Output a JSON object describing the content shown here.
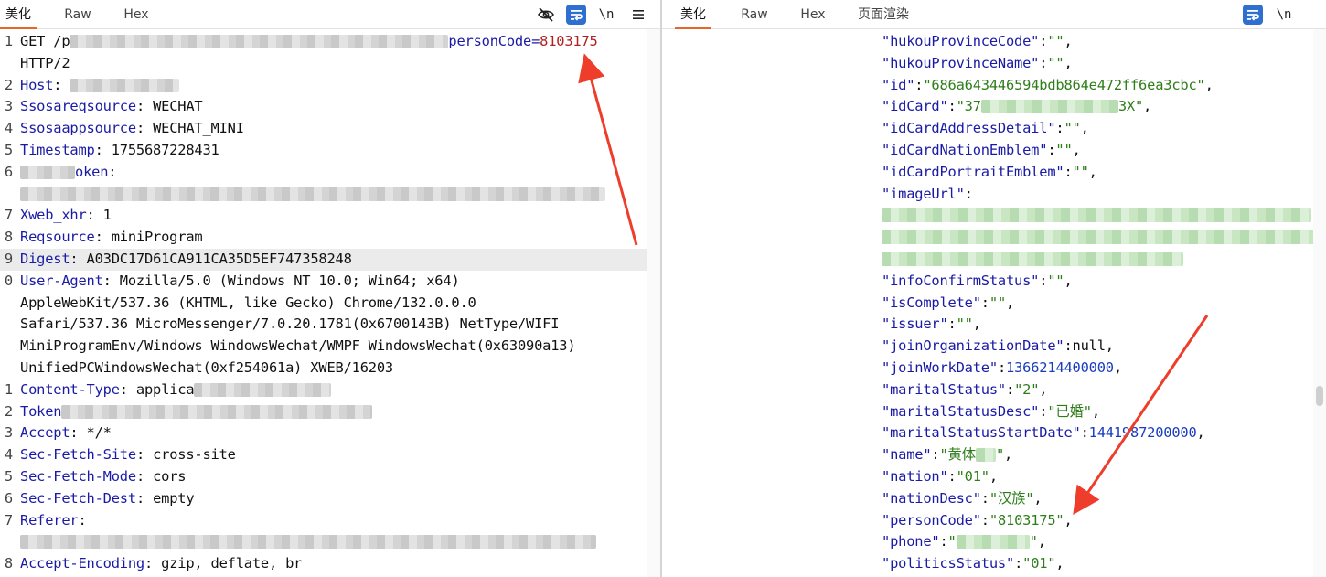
{
  "left": {
    "tabs": [
      "美化",
      "Raw",
      "Hex"
    ],
    "tools": {
      "wrap": "wrap-icon",
      "newline": "\\n",
      "menu": "menu-icon"
    },
    "lines": [
      {
        "no": "1",
        "parts": [
          [
            "v",
            "GET /p"
          ],
          [
            "r",
            ""
          ],
          [
            "red-k",
            "personCode="
          ],
          [
            "red",
            "8103175"
          ]
        ]
      },
      {
        "no": "",
        "parts": [
          [
            "v",
            "HTTP/2"
          ]
        ]
      },
      {
        "no": "2",
        "parts": [
          [
            "k",
            "Host"
          ],
          [
            "v",
            ": "
          ],
          [
            "r",
            ""
          ]
        ]
      },
      {
        "no": "3",
        "parts": [
          [
            "k",
            "Ssosareqsource"
          ],
          [
            "v",
            ": WECHAT"
          ]
        ]
      },
      {
        "no": "4",
        "parts": [
          [
            "k",
            "Ssosaappsource"
          ],
          [
            "v",
            ": WECHAT_MINI"
          ]
        ]
      },
      {
        "no": "5",
        "parts": [
          [
            "k",
            "Timestamp"
          ],
          [
            "v",
            ": 1755687228431"
          ]
        ]
      },
      {
        "no": "6",
        "parts": [
          [
            "r",
            ""
          ],
          [
            "k",
            "oken"
          ],
          [
            "v",
            ":"
          ]
        ]
      },
      {
        "no": "",
        "parts": [
          [
            "r",
            ""
          ]
        ]
      },
      {
        "no": "7",
        "parts": [
          [
            "k",
            "Xweb_xhr"
          ],
          [
            "v",
            ": 1"
          ]
        ]
      },
      {
        "no": "8",
        "parts": [
          [
            "k",
            "Reqsource"
          ],
          [
            "v",
            ": miniProgram"
          ]
        ]
      },
      {
        "no": "9",
        "parts": [
          [
            "k",
            "Digest"
          ],
          [
            "v",
            ": A03DC17D61CA911CA35D5EF747358248"
          ]
        ]
      },
      {
        "no": "0",
        "parts": [
          [
            "k",
            "User-Agent"
          ],
          [
            "v",
            ": Mozilla/5.0 (Windows NT 10.0; Win64; x64)"
          ]
        ]
      },
      {
        "no": "",
        "parts": [
          [
            "v",
            "AppleWebKit/537.36 (KHTML, like Gecko) Chrome/132.0.0.0"
          ]
        ]
      },
      {
        "no": "",
        "parts": [
          [
            "v",
            "Safari/537.36 MicroMessenger/7.0.20.1781(0x6700143B) NetType/WIFI"
          ]
        ]
      },
      {
        "no": "",
        "parts": [
          [
            "v",
            "MiniProgramEnv/Windows WindowsWechat/WMPF WindowsWechat(0x63090a13)"
          ]
        ]
      },
      {
        "no": "",
        "parts": [
          [
            "v",
            "UnifiedPCWindowsWechat(0xf254061a) XWEB/16203"
          ]
        ]
      },
      {
        "no": "1",
        "parts": [
          [
            "k",
            "Content-Type"
          ],
          [
            "v",
            ": applica"
          ],
          [
            "r",
            ""
          ]
        ]
      },
      {
        "no": "2",
        "parts": [
          [
            "k",
            "Token"
          ],
          [
            "r",
            ""
          ]
        ]
      },
      {
        "no": "3",
        "parts": [
          [
            "k",
            "Accept"
          ],
          [
            "v",
            ": */*"
          ]
        ]
      },
      {
        "no": "4",
        "parts": [
          [
            "k",
            "Sec-Fetch-Site"
          ],
          [
            "v",
            ": cross-site"
          ]
        ]
      },
      {
        "no": "5",
        "parts": [
          [
            "k",
            "Sec-Fetch-Mode"
          ],
          [
            "v",
            ": cors"
          ]
        ]
      },
      {
        "no": "6",
        "parts": [
          [
            "k",
            "Sec-Fetch-Dest"
          ],
          [
            "v",
            ": empty"
          ]
        ]
      },
      {
        "no": "7",
        "parts": [
          [
            "k",
            "Referer"
          ],
          [
            "v",
            ":"
          ]
        ]
      },
      {
        "no": "",
        "parts": [
          [
            "r",
            ""
          ]
        ]
      },
      {
        "no": "8",
        "parts": [
          [
            "k",
            "Accept-Encoding"
          ],
          [
            "v",
            ": gzip, deflate, br"
          ]
        ]
      }
    ]
  },
  "right": {
    "tabs": [
      "美化",
      "Raw",
      "Hex",
      "页面渲染"
    ],
    "tools": {
      "wrap": "wrap-icon",
      "newline": "\\n"
    },
    "lines": [
      {
        "parts": [
          [
            "k",
            "\"hukouProvinceCode\""
          ],
          [
            "p",
            ":"
          ],
          [
            "s",
            "\"\""
          ],
          [
            "p",
            ","
          ]
        ]
      },
      {
        "parts": [
          [
            "k",
            "\"hukouProvinceName\""
          ],
          [
            "p",
            ":"
          ],
          [
            "s",
            "\"\""
          ],
          [
            "p",
            ","
          ]
        ]
      },
      {
        "parts": [
          [
            "k",
            "\"id\""
          ],
          [
            "p",
            ":"
          ],
          [
            "s",
            "\"686a643446594bdb864e472ff6ea3cbc\""
          ],
          [
            "p",
            ","
          ]
        ]
      },
      {
        "parts": [
          [
            "k",
            "\"idCard\""
          ],
          [
            "p",
            ":"
          ],
          [
            "s",
            "\"37"
          ],
          [
            "rg",
            ""
          ],
          [
            "s",
            "3X\""
          ],
          [
            "p",
            ","
          ]
        ]
      },
      {
        "parts": [
          [
            "k",
            "\"idCardAddressDetail\""
          ],
          [
            "p",
            ":"
          ],
          [
            "s",
            "\"\""
          ],
          [
            "p",
            ","
          ]
        ]
      },
      {
        "parts": [
          [
            "k",
            "\"idCardNationEmblem\""
          ],
          [
            "p",
            ":"
          ],
          [
            "s",
            "\"\""
          ],
          [
            "p",
            ","
          ]
        ]
      },
      {
        "parts": [
          [
            "k",
            "\"idCardPortraitEmblem\""
          ],
          [
            "p",
            ":"
          ],
          [
            "s",
            "\"\""
          ],
          [
            "p",
            ","
          ]
        ]
      },
      {
        "parts": [
          [
            "k",
            "\"imageUrl\""
          ],
          [
            "p",
            ":"
          ]
        ]
      },
      {
        "parts": [
          [
            "rg",
            ""
          ]
        ]
      },
      {
        "parts": [
          [
            "rg",
            ""
          ]
        ]
      },
      {
        "parts": [
          [
            "rg",
            ""
          ]
        ]
      },
      {
        "parts": [
          [
            "k",
            "\"infoConfirmStatus\""
          ],
          [
            "p",
            ":"
          ],
          [
            "s",
            "\"\""
          ],
          [
            "p",
            ","
          ]
        ]
      },
      {
        "parts": [
          [
            "k",
            "\"isComplete\""
          ],
          [
            "p",
            ":"
          ],
          [
            "s",
            "\"\""
          ],
          [
            "p",
            ","
          ]
        ]
      },
      {
        "parts": [
          [
            "k",
            "\"issuer\""
          ],
          [
            "p",
            ":"
          ],
          [
            "s",
            "\"\""
          ],
          [
            "p",
            ","
          ]
        ]
      },
      {
        "parts": [
          [
            "k",
            "\"joinOrganizationDate\""
          ],
          [
            "p",
            ":null,"
          ]
        ]
      },
      {
        "parts": [
          [
            "k",
            "\"joinWorkDate\""
          ],
          [
            "p",
            ":"
          ],
          [
            "n",
            "1366214400000"
          ],
          [
            "p",
            ","
          ]
        ]
      },
      {
        "parts": [
          [
            "k",
            "\"maritalStatus\""
          ],
          [
            "p",
            ":"
          ],
          [
            "s",
            "\"2\""
          ],
          [
            "p",
            ","
          ]
        ]
      },
      {
        "parts": [
          [
            "k",
            "\"maritalStatusDesc\""
          ],
          [
            "p",
            ":"
          ],
          [
            "s",
            "\"已婚\""
          ],
          [
            "p",
            ","
          ]
        ]
      },
      {
        "parts": [
          [
            "k",
            "\"maritalStatusStartDate\""
          ],
          [
            "p",
            ":"
          ],
          [
            "n",
            "1441987200000"
          ],
          [
            "p",
            ","
          ]
        ]
      },
      {
        "parts": [
          [
            "k",
            "\"name\""
          ],
          [
            "p",
            ":"
          ],
          [
            "s",
            "\"黄体"
          ],
          [
            "rg",
            ""
          ],
          [
            "s",
            "\""
          ],
          [
            "p",
            ","
          ]
        ]
      },
      {
        "parts": [
          [
            "k",
            "\"nation\""
          ],
          [
            "p",
            ":"
          ],
          [
            "s",
            "\"01\""
          ],
          [
            "p",
            ","
          ]
        ]
      },
      {
        "parts": [
          [
            "k",
            "\"nationDesc\""
          ],
          [
            "p",
            ":"
          ],
          [
            "s",
            "\"汉族\""
          ],
          [
            "p",
            ","
          ]
        ]
      },
      {
        "parts": [
          [
            "k",
            "\"personCode\""
          ],
          [
            "p",
            ":"
          ],
          [
            "s",
            "\"8103175\""
          ],
          [
            "p",
            ","
          ]
        ]
      },
      {
        "parts": [
          [
            "k",
            "\"phone\""
          ],
          [
            "p",
            ":"
          ],
          [
            "s",
            "\""
          ],
          [
            "rg",
            ""
          ],
          [
            "s",
            "\""
          ],
          [
            "p",
            ","
          ]
        ]
      },
      {
        "parts": [
          [
            "k",
            "\"politicsStatus\""
          ],
          [
            "p",
            ":"
          ],
          [
            "s",
            "\"01\""
          ],
          [
            "p",
            ","
          ]
        ]
      }
    ]
  },
  "colors": {
    "key": "#1a1aa6",
    "highlight": "#b32020",
    "string": "#2e7d1a",
    "number": "#1a3dbf",
    "accent": "#e8652a",
    "arrow": "#ee3d2a"
  }
}
